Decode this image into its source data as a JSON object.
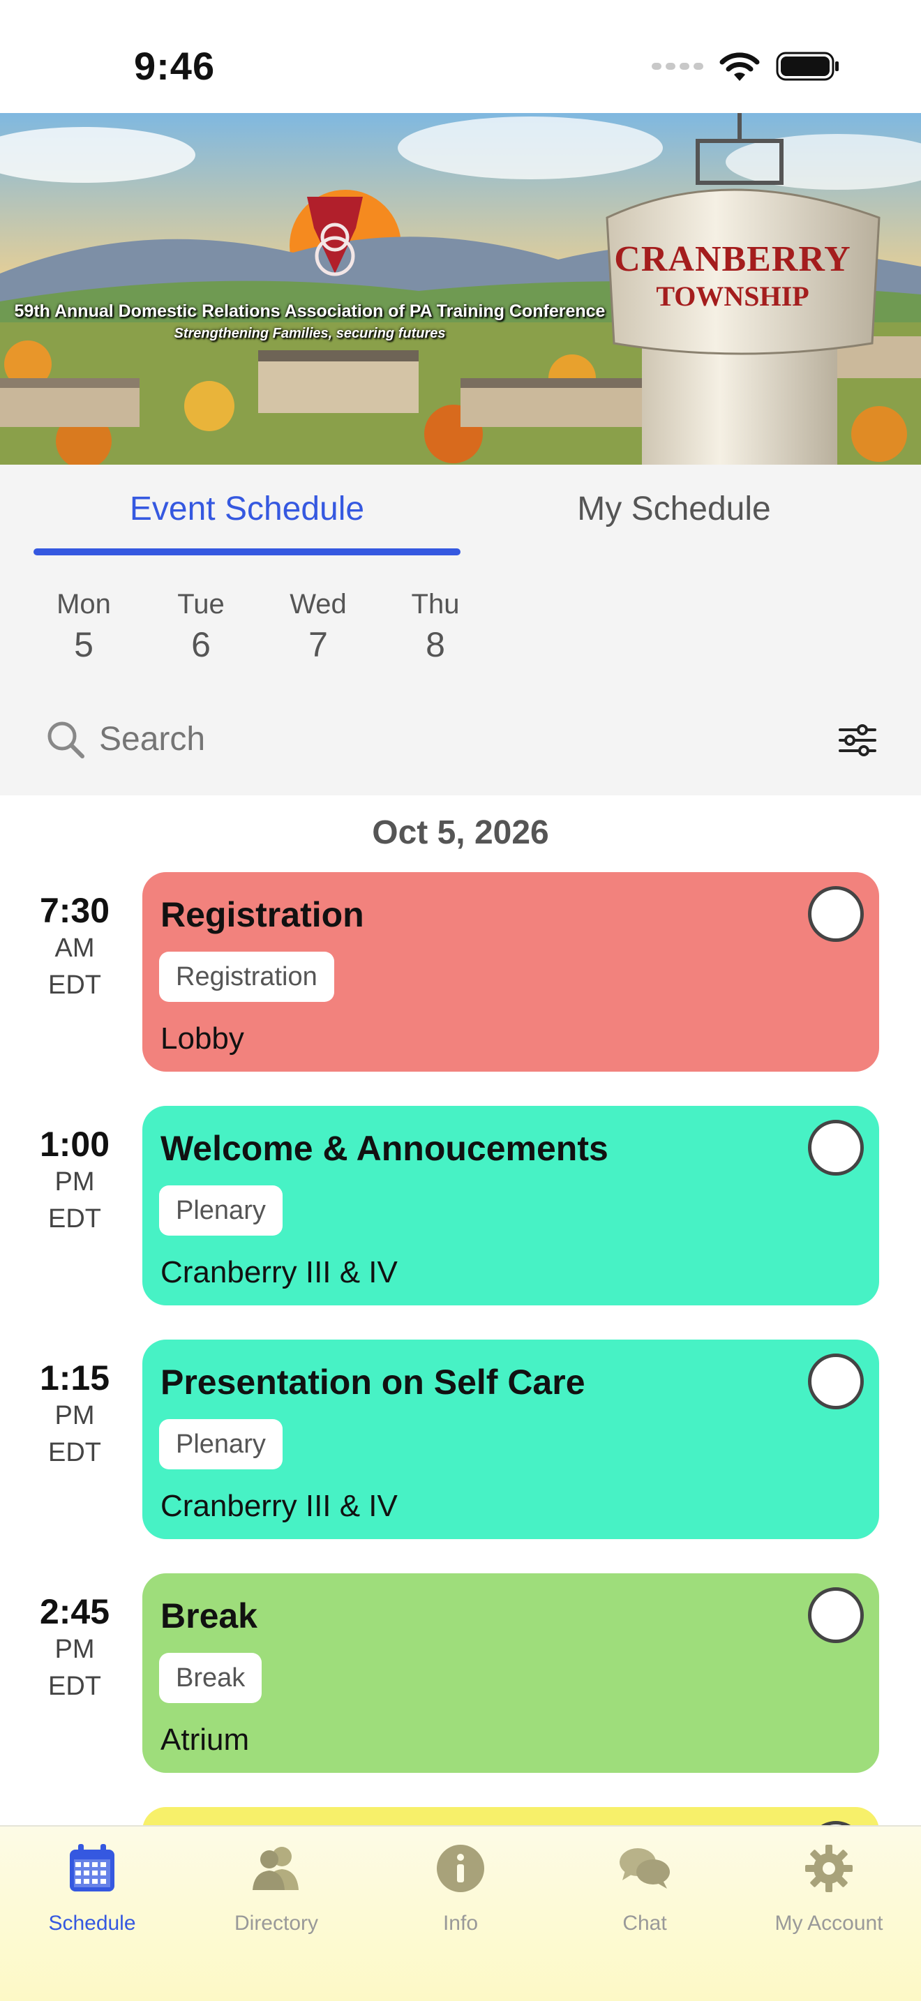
{
  "status_bar": {
    "time": "9:46"
  },
  "banner": {
    "title": "59th Annual Domestic Relations Association of PA Training Conference",
    "subtitle": "Strengthening Families, securing futures",
    "tower_line1": "CRANBERRY",
    "tower_line2": "TOWNSHIP"
  },
  "tabs": {
    "event_schedule": "Event Schedule",
    "my_schedule": "My Schedule"
  },
  "days": [
    {
      "name": "Mon",
      "num": "5"
    },
    {
      "name": "Tue",
      "num": "6"
    },
    {
      "name": "Wed",
      "num": "7"
    },
    {
      "name": "Thu",
      "num": "8"
    }
  ],
  "search": {
    "placeholder": "Search"
  },
  "date_header": "Oct 5, 2026",
  "events": [
    {
      "hour": "7:30",
      "ampm": "AM",
      "zone": "EDT",
      "title": "Registration",
      "tag": "Registration",
      "location": "Lobby",
      "color": "#f2827d"
    },
    {
      "hour": "1:00",
      "ampm": "PM",
      "zone": "EDT",
      "title": "Welcome & Annoucements",
      "tag": "Plenary",
      "location": "Cranberry III & IV",
      "color": "#47f2c5"
    },
    {
      "hour": "1:15",
      "ampm": "PM",
      "zone": "EDT",
      "title": "Presentation on Self Care",
      "tag": "Plenary",
      "location": "Cranberry III & IV",
      "color": "#47f2c5"
    },
    {
      "hour": "2:45",
      "ampm": "PM",
      "zone": "EDT",
      "title": "Break",
      "tag": "Break",
      "location": "Atrium",
      "color": "#9edd7b"
    }
  ],
  "tabbar": [
    {
      "label": "Schedule",
      "icon": "calendar-icon",
      "active": true
    },
    {
      "label": "Directory",
      "icon": "person-icon"
    },
    {
      "label": "Info",
      "icon": "info-icon"
    },
    {
      "label": "Chat",
      "icon": "chat-bubbles-icon"
    },
    {
      "label": "My Account",
      "icon": "gear-icon"
    }
  ],
  "colors": {
    "accent": "#3558e0",
    "partial_next_event": "#f7f06a"
  }
}
